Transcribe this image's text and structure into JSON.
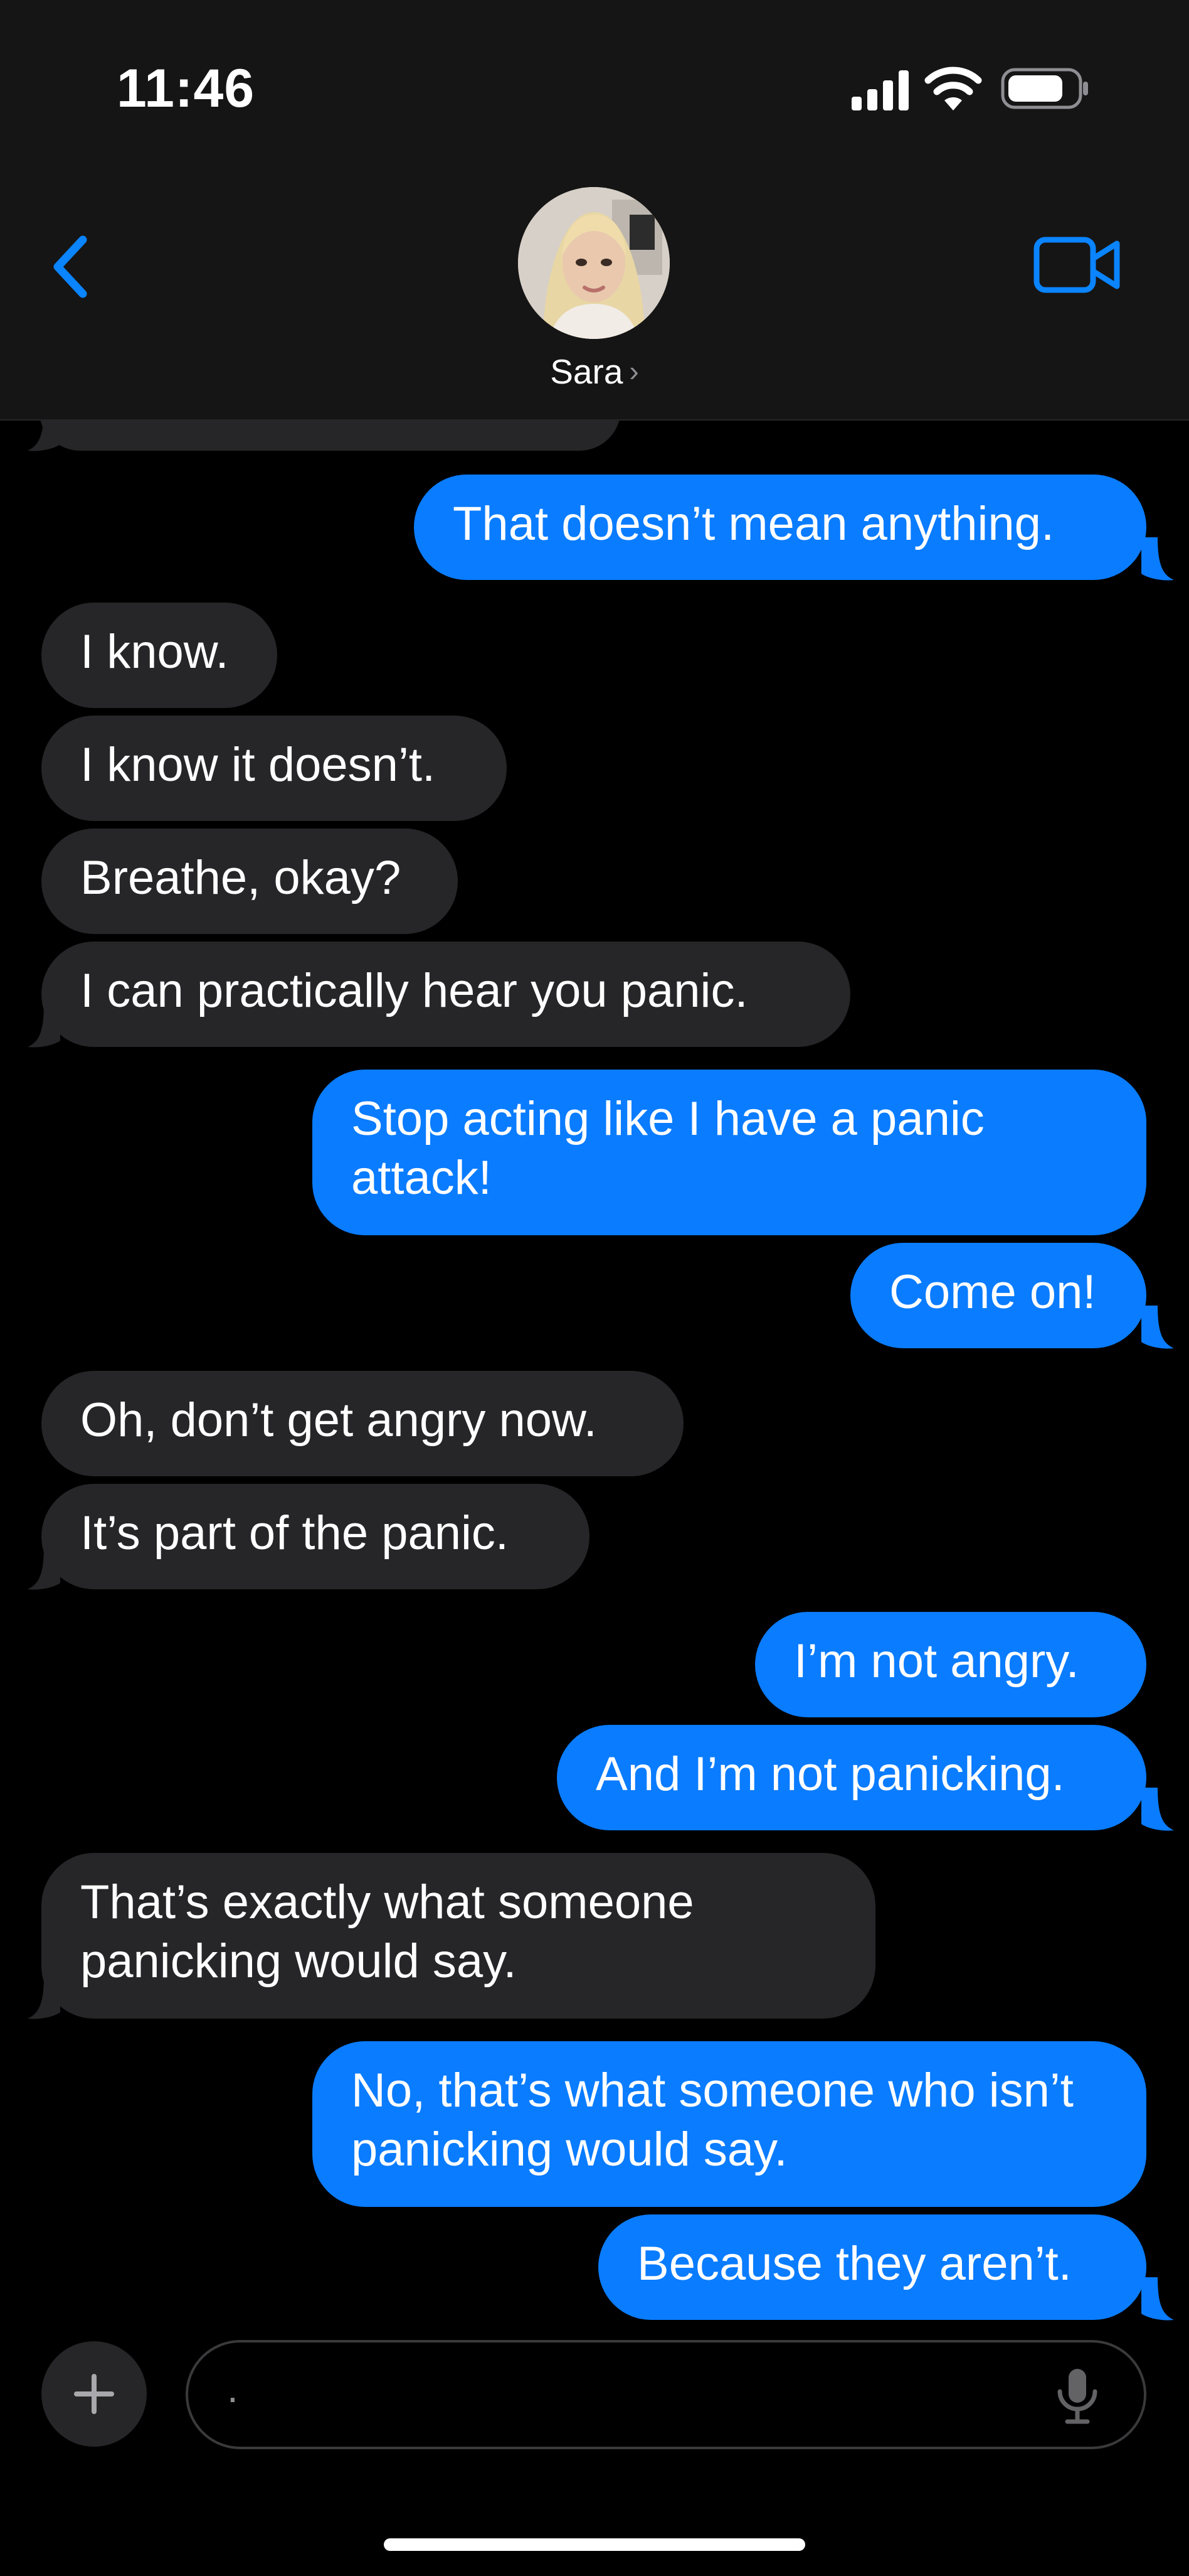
{
  "status": {
    "time": "11:46"
  },
  "header": {
    "contact_name": "Sara",
    "chevron": "›"
  },
  "messages": [
    {
      "from": "in",
      "text": "",
      "partial": true
    },
    {
      "from": "out",
      "text": "That doesn’t mean anything."
    },
    {
      "from": "in",
      "text": "I know."
    },
    {
      "from": "in",
      "text": "I know it doesn’t."
    },
    {
      "from": "in",
      "text": "Breathe, okay?"
    },
    {
      "from": "in",
      "text": "I can practically hear you panic."
    },
    {
      "from": "out",
      "text": "Stop acting like I have a panic attack!"
    },
    {
      "from": "out",
      "text": "Come on!"
    },
    {
      "from": "in",
      "text": "Oh, don’t get angry now."
    },
    {
      "from": "in",
      "text": "It’s part of the panic."
    },
    {
      "from": "out",
      "text": "I’m not angry."
    },
    {
      "from": "out",
      "text": "And I’m not panicking."
    },
    {
      "from": "in",
      "text": "That’s exactly what someone panicking would say."
    },
    {
      "from": "out",
      "text": "No, that’s what someone who isn’t panicking would say."
    },
    {
      "from": "out",
      "text": "Because they aren’t."
    }
  ],
  "composer": {
    "value": ".",
    "icons": [
      "plus-icon",
      "microphone-icon"
    ]
  },
  "colors": {
    "outgoing_bubble": "#0a7cff",
    "incoming_bubble": "#262628",
    "accent": "#0a84ff",
    "background": "#000000",
    "header_background": "#151515"
  }
}
